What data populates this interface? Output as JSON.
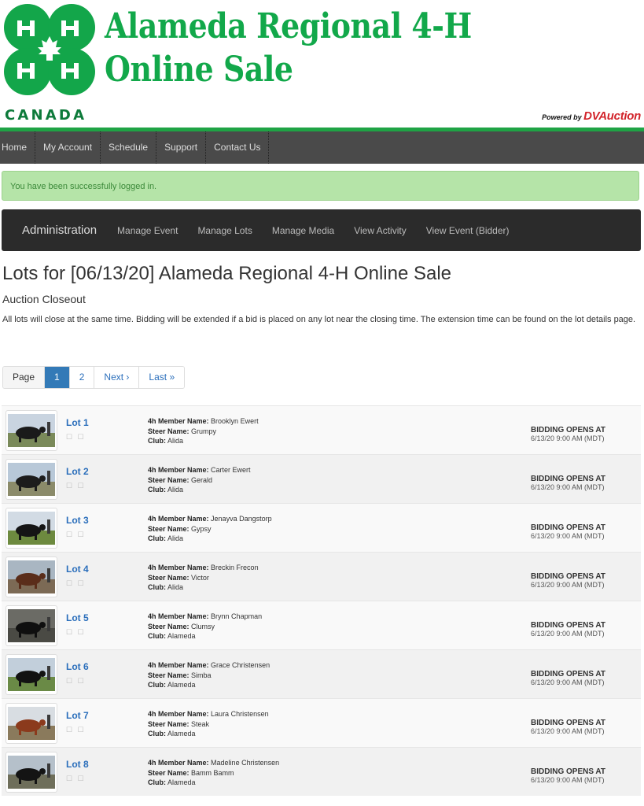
{
  "header": {
    "title_line1": "Alameda Regional 4-H",
    "title_line2": "Online Sale",
    "country": "CANADA",
    "powered_label": "Powered by",
    "powered_brand": "DVAuction"
  },
  "topnav": [
    "Home",
    "My Account",
    "Schedule",
    "Support",
    "Contact Us"
  ],
  "alert": "You have been successfully logged in.",
  "admin": {
    "brand": "Administration",
    "links": [
      "Manage Event",
      "Manage Lots",
      "Manage Media",
      "View Activity",
      "View Event (Bidder)"
    ]
  },
  "page": {
    "title": "Lots for [06/13/20] Alameda Regional 4-H Online Sale",
    "subtitle": "Auction Closeout",
    "description": "All lots will close at the same time. Bidding will be extended if a bid is placed on any lot near the closing time. The extension time can be found on the lot details page."
  },
  "pagination": {
    "label": "Page",
    "pages": [
      "1",
      "2"
    ],
    "active": "1",
    "next": "Next ›",
    "last": "Last »"
  },
  "labels": {
    "member": "4h Member Name:",
    "steer": "Steer Name:",
    "club": "Club:",
    "boxes": "☐ ☐"
  },
  "lots": [
    {
      "lot": "Lot 1",
      "member": "Brooklyn Ewert",
      "steer": "Grumpy",
      "club": "Alida",
      "status": "BIDDING OPENS AT",
      "date": "6/13/20 9:00 AM (MDT)"
    },
    {
      "lot": "Lot 2",
      "member": "Carter Ewert",
      "steer": "Gerald",
      "club": "Alida",
      "status": "BIDDING OPENS AT",
      "date": "6/13/20 9:00 AM (MDT)"
    },
    {
      "lot": "Lot 3",
      "member": "Jenayva Dangstorp",
      "steer": "Gypsy",
      "club": "Alida",
      "status": "BIDDING OPENS AT",
      "date": "6/13/20 9:00 AM (MDT)"
    },
    {
      "lot": "Lot 4",
      "member": "Breckin Frecon",
      "steer": "Victor",
      "club": "Alida",
      "status": "BIDDING OPENS AT",
      "date": "6/13/20 9:00 AM (MDT)"
    },
    {
      "lot": "Lot 5",
      "member": "Brynn Chapman",
      "steer": "Clumsy",
      "club": "Alameda",
      "status": "BIDDING OPENS AT",
      "date": "6/13/20 9:00 AM (MDT)"
    },
    {
      "lot": "Lot 6",
      "member": "Grace Christensen",
      "steer": "Simba",
      "club": "Alameda",
      "status": "BIDDING OPENS AT",
      "date": "6/13/20 9:00 AM (MDT)"
    },
    {
      "lot": "Lot 7",
      "member": "Laura Christensen",
      "steer": "Steak",
      "club": "Alameda",
      "status": "BIDDING OPENS AT",
      "date": "6/13/20 9:00 AM (MDT)"
    },
    {
      "lot": "Lot 8",
      "member": "Madeline Christensen",
      "steer": "Bamm Bamm",
      "club": "Alameda",
      "status": "BIDDING OPENS AT",
      "date": "6/13/20 9:00 AM (MDT)"
    }
  ],
  "colors": {
    "brand_green": "#12a84a",
    "nav_bg": "#4a4a4a",
    "admin_bg": "#2b2b2b",
    "alert_bg": "#b5e4a8",
    "link_blue": "#2a6ebb",
    "dv_red": "#d2232a"
  }
}
